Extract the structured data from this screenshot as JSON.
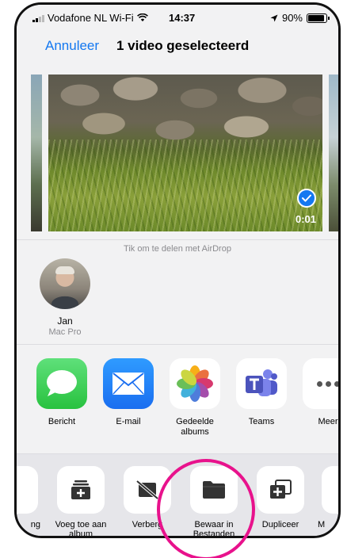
{
  "status_bar": {
    "carrier": "Vodafone NL Wi-Fi",
    "time": "14:37",
    "battery": "90%",
    "battery_level": 0.9
  },
  "nav": {
    "cancel_label": "Annuleer",
    "title": "1 video geselecteerd"
  },
  "media": {
    "duration": "0:01",
    "selected": true
  },
  "airdrop": {
    "hint": "Tik om te delen met AirDrop",
    "contacts": [
      {
        "name": "Jan",
        "device": "Mac Pro"
      }
    ]
  },
  "apps": [
    {
      "label": "Bericht",
      "icon": "messages-icon"
    },
    {
      "label": "E-mail",
      "icon": "mail-icon"
    },
    {
      "label": "Gedeelde albums",
      "icon": "photos-icon"
    },
    {
      "label": "Teams",
      "icon": "teams-icon"
    },
    {
      "label": "Meer",
      "icon": "more-icon"
    }
  ],
  "actions": [
    {
      "label": "ng",
      "icon": "partial-icon"
    },
    {
      "label": "Voeg toe aan album",
      "icon": "add-to-album-icon"
    },
    {
      "label": "Verberg",
      "icon": "hide-icon"
    },
    {
      "label": "Bewaar in Bestanden",
      "icon": "folder-icon"
    },
    {
      "label": "Dupliceer",
      "icon": "duplicate-icon"
    },
    {
      "label": "M",
      "icon": "partial-more-icon"
    }
  ],
  "colors": {
    "accent": "#1478f0",
    "highlight": "#e8128c"
  }
}
